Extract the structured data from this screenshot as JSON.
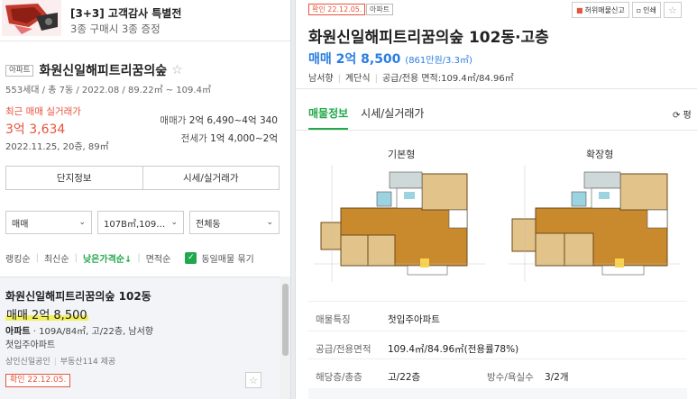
{
  "banner": {
    "title": "[3+3] 고객감사 특별전",
    "subtitle": "3종 구매시 3종 증정"
  },
  "complex": {
    "type_tag": "아파트",
    "name": "화원신일해피트리꿈의숲",
    "star": "☆",
    "meta": "553세대 / 총 7동 / 2022.08 / 89.22㎡ ~ 109.4㎡",
    "recent_label": "최근 매매 실거래가",
    "recent_price": "3억 3,634",
    "recent_date": "2022.11.25, 20층, 89㎡",
    "sale_range_label": "매매가",
    "sale_range": "2억 6,490~4억 340",
    "jeonse_range_label": "전세가",
    "jeonse_range": "1억 4,000~2억",
    "btn_info": "단지정보",
    "btn_trade": "시세/실거래가"
  },
  "filters": {
    "trade_type": "매매",
    "area": "107B㎡,109…",
    "dong": "전체동",
    "chevron": "⌄"
  },
  "sort": {
    "items": [
      "랭킹순",
      "최신순",
      "낮은가격순↓",
      "면적순"
    ],
    "active_index": 2,
    "same_bundle_label": "동일매물 묶기",
    "check": "✓"
  },
  "listing": {
    "title": "화원신일해피트리꿈의숲 102동",
    "price": "매매 2억 8,500",
    "info_type": "아파트",
    "info": "109A/84㎡, 고/22층, 남서향",
    "desc": "첫입주아파트",
    "agent": "상인신일공인",
    "provider": "부동산114 제공",
    "confirm": "확인 22.12.05.",
    "star": "☆"
  },
  "detail": {
    "confirm": "확인 22.12.05.",
    "type_tag": "아파트",
    "report_label": "허위매물신고",
    "print_label": "인쇄",
    "star": "☆",
    "title": "화원신일해피트리꿈의숲 102동·고층",
    "price": "매매 2억 8,500",
    "price_per": "(861만원/3.3㎡)",
    "direction": "남서향",
    "stairs": "계단식",
    "area_label": "공급/전용 면적",
    "area_value": "109.4㎡/84.96㎡",
    "tabs": [
      "매물정보",
      "시세/실거래가"
    ],
    "active_tab": 0,
    "refresh": "⟳ 평",
    "plan_basic": "기본형",
    "plan_expanded": "확장형",
    "rows": [
      {
        "k": "매물특징",
        "v": "첫입주아파트"
      },
      {
        "k": "공급/전용면적",
        "v": "109.4㎡/84.96㎡(전용률78%)"
      },
      {
        "k": "해당층/총층",
        "v": "고/22층",
        "k2": "방수/욕실수",
        "v2": "3/2개"
      }
    ]
  },
  "colors": {
    "accent_green": "#22a84c",
    "price_blue": "#2a7ee0",
    "alert_red": "#e8533c",
    "highlight_yellow": "#f3f05a",
    "plan_orange": "#c98a2e"
  }
}
